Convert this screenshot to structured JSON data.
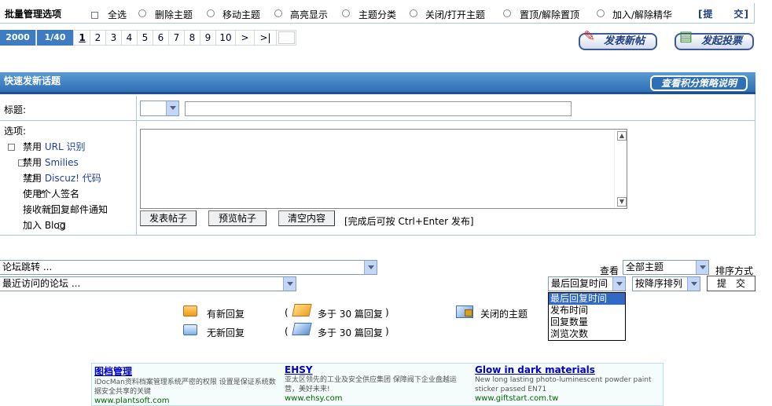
{
  "batch": {
    "title": "批量管理选项",
    "select_all": "全选",
    "options": [
      "删除主题",
      "移动主题",
      "高亮显示",
      "主题分类",
      "关闭/打开主题",
      "置顶/解除置顶",
      "加入/解除精华"
    ],
    "submit": "[提　　交]"
  },
  "pager": {
    "total": "2000",
    "position": "1/40",
    "pages": [
      "1",
      "2",
      "3",
      "4",
      "5",
      "6",
      "7",
      "8",
      "9",
      "10"
    ],
    "next": ">",
    "last": ">|"
  },
  "actions": {
    "new_post": "发表新帖",
    "new_poll": "发起投票"
  },
  "quick": {
    "header": "快速发新话题",
    "policy": "查看积分策略说明",
    "subject_label": "标题:",
    "options_label": "选项:",
    "options": [
      {
        "prefix": "禁用 ",
        "link": "URL 识别",
        "checked": false
      },
      {
        "prefix": "禁用 ",
        "link": "Smilies",
        "checked": false
      },
      {
        "prefix": "禁用 ",
        "link": "Discuz! 代码",
        "checked": false
      },
      {
        "prefix": "使用个人签名",
        "link": "",
        "checked": true
      },
      {
        "prefix": "接收新回复邮件通知",
        "link": "",
        "checked": false
      },
      {
        "prefix": "加入 Blog",
        "link": "",
        "checked": false
      }
    ],
    "btn_post": "发表帖子",
    "btn_preview": "预览帖子",
    "btn_clear": "清空内容",
    "hint": "[完成后可按 Ctrl+Enter 发布]"
  },
  "nav": {
    "jump": "论坛跳转 ...",
    "recent": "最近访问的论坛 ...",
    "view_label": "查看",
    "view_value": "全部主题",
    "sort_label": "排序方式",
    "sort_field": "最后回复时间",
    "sort_order": "按降序排列",
    "submit": "提　交",
    "sort_options": [
      "最后回复时间",
      "发布时间",
      "回复数量",
      "浏览次数"
    ]
  },
  "legend": {
    "new_reply": "有新回复",
    "no_new_reply": "无新回复",
    "hot_paren_open": "(",
    "hot": "多于 30 篇回复",
    "hot_paren_close": ")",
    "closed": "关闭的主题"
  },
  "ads": [
    {
      "title": "图档管理",
      "text": "iDocMan资料档案管理系统严密的权限 设置是保证系统数据安全共享的关键",
      "url": "www.plantsoft.com"
    },
    {
      "title": "EHSY",
      "text": "亚太区领先的工业及安全供应集团 保障阀下企业盘越运营，美好未来!",
      "url": "www.ehsy.com"
    },
    {
      "title": "Glow in dark materials",
      "text": "New long lasting photo-luminescent powder paint sticker passed EN71",
      "url": "www.giftstart.com.tw"
    }
  ],
  "colors": {
    "header_blue": "#3a7fc0",
    "pager_blue": "#3d7cc0",
    "border": "#a8c8e0"
  }
}
